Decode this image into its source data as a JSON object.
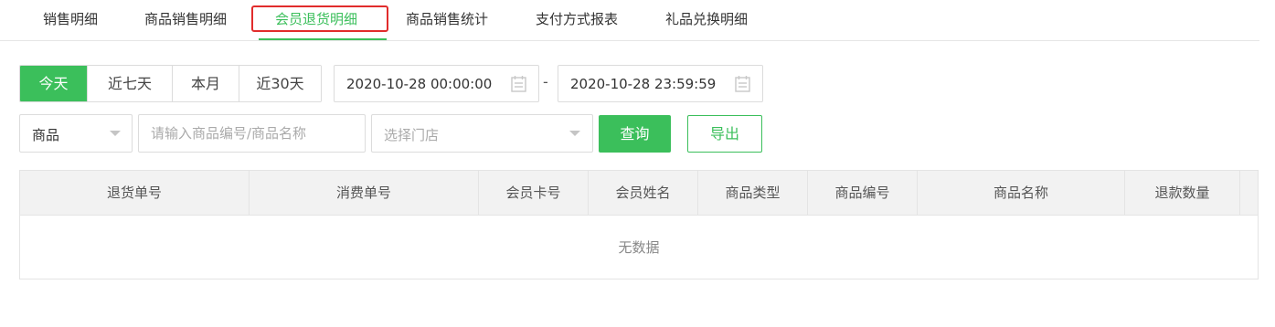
{
  "tabs": [
    {
      "label": "销售明细"
    },
    {
      "label": "商品销售明细"
    },
    {
      "label": "会员退货明细"
    },
    {
      "label": "商品销售统计"
    },
    {
      "label": "支付方式报表"
    },
    {
      "label": "礼品兑换明细"
    }
  ],
  "active_tab": "会员退货明细",
  "date_range_buttons": [
    {
      "label": "今天"
    },
    {
      "label": "近七天"
    },
    {
      "label": "本月"
    },
    {
      "label": "近30天"
    }
  ],
  "active_range": "今天",
  "start_date": {
    "value": "2020-10-28 00:00:00",
    "icon": "calendar-icon"
  },
  "date_separator": "-",
  "end_date": {
    "value": "2020-10-28 23:59:59",
    "icon": "calendar-icon"
  },
  "filter": {
    "type_select": "商品",
    "search_placeholder": "请输入商品编号/商品名称",
    "store_placeholder": "选择门店",
    "query_label": "查询",
    "export_label": "导出"
  },
  "table": {
    "columns": [
      "退货单号",
      "消费单号",
      "会员卡号",
      "会员姓名",
      "商品类型",
      "商品编号",
      "商品名称",
      "退款数量"
    ],
    "rows": [],
    "empty_text": "无数据"
  },
  "colors": {
    "accent": "#3bbf5b",
    "highlight_border": "#e12c2c",
    "header_bg": "#f2f2f2"
  }
}
